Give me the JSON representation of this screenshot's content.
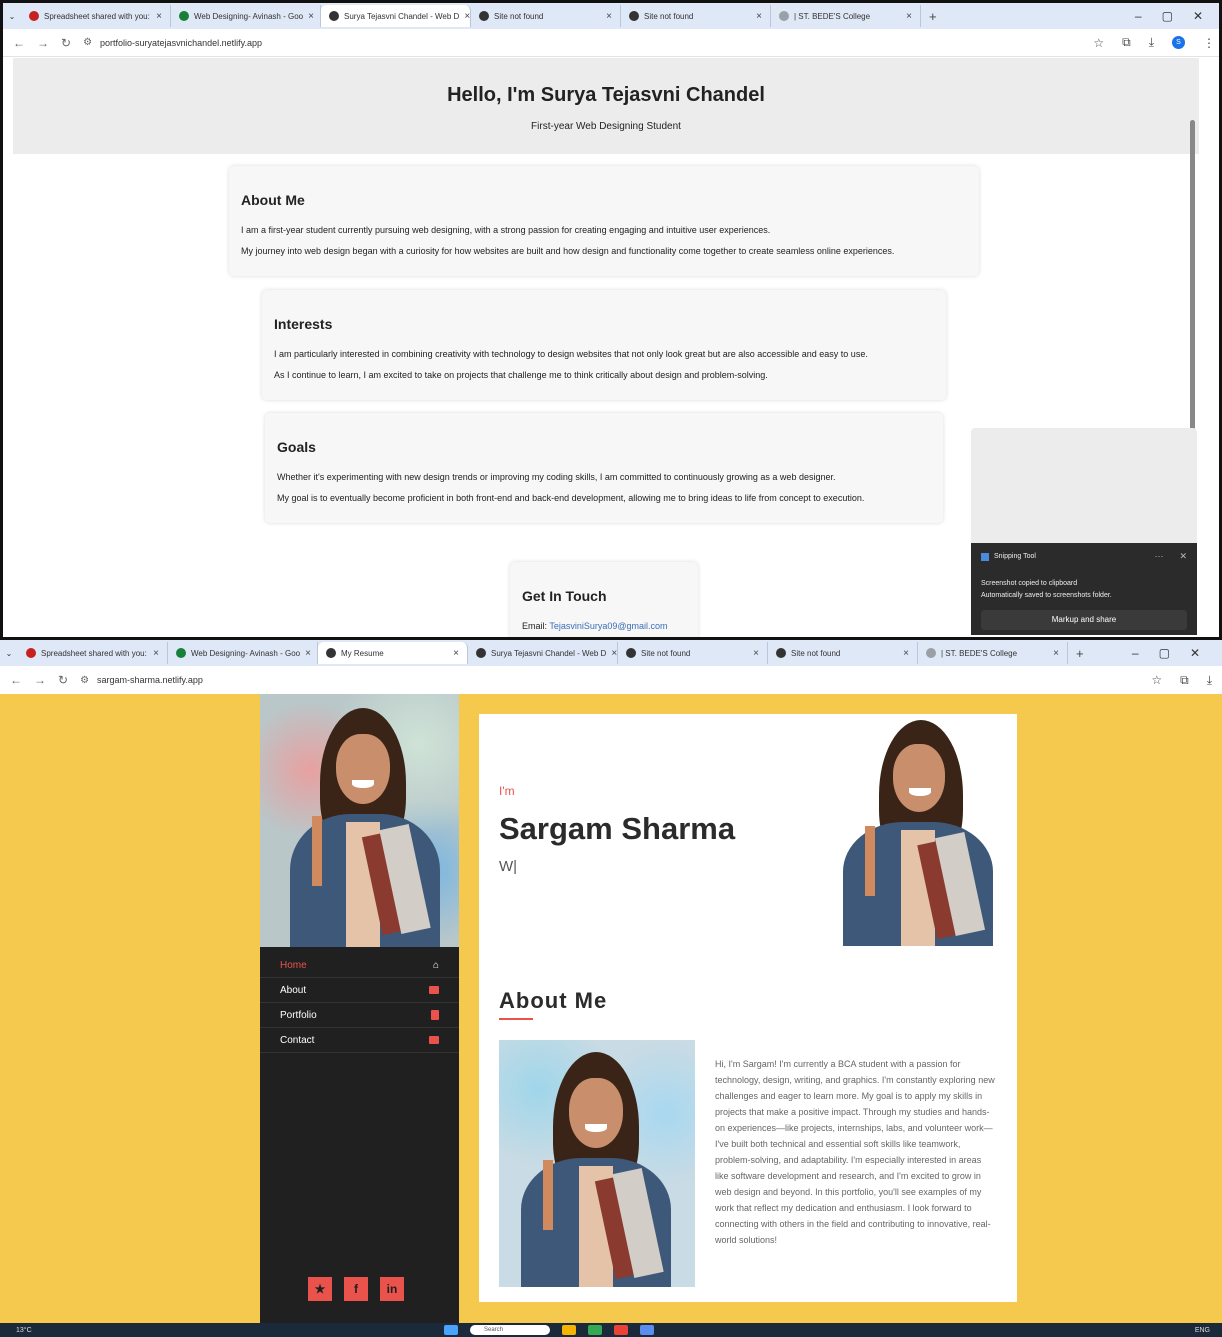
{
  "top_window": {
    "tabs": [
      {
        "title": "Spreadsheet shared with you:",
        "fav_color": "#c5221f"
      },
      {
        "title": "Web Designing- Avinash - Goo",
        "fav_color": "#188038"
      },
      {
        "title": "Surya Tejasvni Chandel - Web D",
        "fav_color": "#333333",
        "active": true
      },
      {
        "title": "Site not found",
        "fav_color": "#333333"
      },
      {
        "title": "Site not found",
        "fav_color": "#333333"
      },
      {
        "title": "| ST. BEDE'S College",
        "fav_color": "#9aa0a6"
      }
    ],
    "url": "portfolio-suryatejasvnichandel.netlify.app",
    "hero_title": "Hello, I'm Surya Tejasvni Chandel",
    "hero_subtitle": "First-year Web Designing Student",
    "about": {
      "heading": "About Me",
      "p1": "I am a first-year student currently pursuing web designing, with a strong passion for creating engaging and intuitive user experiences.",
      "p2": "My journey into web design began with a curiosity for how websites are built and how design and functionality come together to create seamless online experiences."
    },
    "interests": {
      "heading": "Interests",
      "p1": "I am particularly interested in combining creativity with technology to design websites that not only look great but are also accessible and easy to use.",
      "p2": "As I continue to learn, I am excited to take on projects that challenge me to think critically about design and problem-solving."
    },
    "goals": {
      "heading": "Goals",
      "p1": "Whether it's experimenting with new design trends or improving my coding skills, I am committed to continuously growing as a web designer.",
      "p2": "My goal is to eventually become proficient in both front-end and back-end development, allowing me to bring ideas to life from concept to execution."
    },
    "contact": {
      "heading": "Get In Touch",
      "email_label": "Email:",
      "email": "TejasviniSurya09@gmail.com"
    },
    "toast": {
      "app": "Snipping Tool",
      "line1": "Screenshot copied to clipboard",
      "line2": "Automatically saved to screenshots folder.",
      "button": "Markup and share"
    }
  },
  "bottom_window": {
    "tabs": [
      {
        "title": "Spreadsheet shared with you:",
        "fav_color": "#c5221f"
      },
      {
        "title": "Web Designing- Avinash - Goo",
        "fav_color": "#188038"
      },
      {
        "title": "My Resume",
        "fav_color": "#333333",
        "active": true
      },
      {
        "title": "Surya Tejasvni Chandel - Web D",
        "fav_color": "#333333"
      },
      {
        "title": "Site not found",
        "fav_color": "#333333"
      },
      {
        "title": "Site not found",
        "fav_color": "#333333"
      },
      {
        "title": "| ST. BEDE'S College",
        "fav_color": "#9aa0a6"
      }
    ],
    "url": "sargam-sharma.netlify.app",
    "nav": [
      {
        "label": "Home",
        "active": true,
        "icon": "home-icon"
      },
      {
        "label": "About",
        "icon": "id-card-icon"
      },
      {
        "label": "Portfolio",
        "icon": "file-icon"
      },
      {
        "label": "Contact",
        "icon": "envelope-icon"
      }
    ],
    "socials": [
      {
        "glyph": "★",
        "icon": "twitter-icon"
      },
      {
        "glyph": "f",
        "icon": "facebook-icon"
      },
      {
        "glyph": "in",
        "icon": "linkedin-icon"
      }
    ],
    "im": "I'm",
    "name": "Sargam Sharma",
    "typed": "W|",
    "about_heading": "About Me",
    "bio": "Hi, I'm Sargam! I'm currently a BCA student with a passion for technology, design, writing, and graphics. I'm constantly exploring new challenges and eager to learn more. My goal is to apply my skills in projects that make a positive impact. Through my studies and hands-on experiences—like projects, internships, labs, and volunteer work—I've built both technical and essential soft skills like teamwork, problem-solving, and adaptability. I'm especially interested in areas like software development and research, and I'm excited to grow in web design and beyond. In this portfolio, you'll see examples of my work that reflect my dedication and enthusiasm. I look forward to connecting with others in the field and contributing to innovative, real-world solutions!",
    "accent": "#e9534b",
    "background": "#f4c94d"
  },
  "taskbar": {
    "weather": "13°C",
    "search": "Search",
    "lang": "ENG"
  }
}
